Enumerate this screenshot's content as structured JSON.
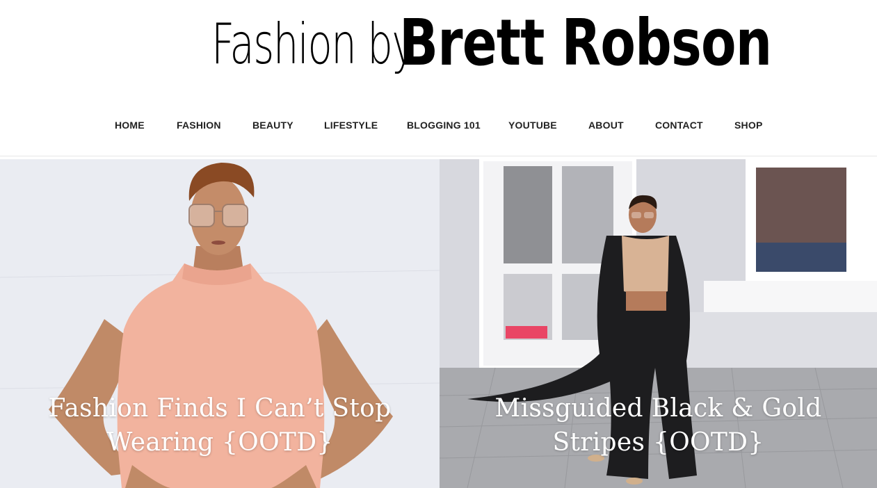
{
  "site": {
    "logo_light": "Fashion by",
    "logo_bold": "Brett Robson"
  },
  "nav": {
    "items": [
      {
        "label": "HOME"
      },
      {
        "label": "FASHION"
      },
      {
        "label": "BEAUTY"
      },
      {
        "label": "LIFESTYLE"
      },
      {
        "label": "BLOGGING 101"
      },
      {
        "label": "YOUTUBE"
      },
      {
        "label": "ABOUT"
      },
      {
        "label": "CONTACT"
      },
      {
        "label": "SHOP"
      }
    ]
  },
  "posts": [
    {
      "title": "Fashion Finds I Can’t Stop Wearing {OOTD}"
    },
    {
      "title": "Missguided Black & Gold Stripes {OOTD}"
    }
  ],
  "colors": {
    "nav_text": "#222222",
    "title_text": "#ffffff",
    "divider": "#e6e6e6"
  }
}
